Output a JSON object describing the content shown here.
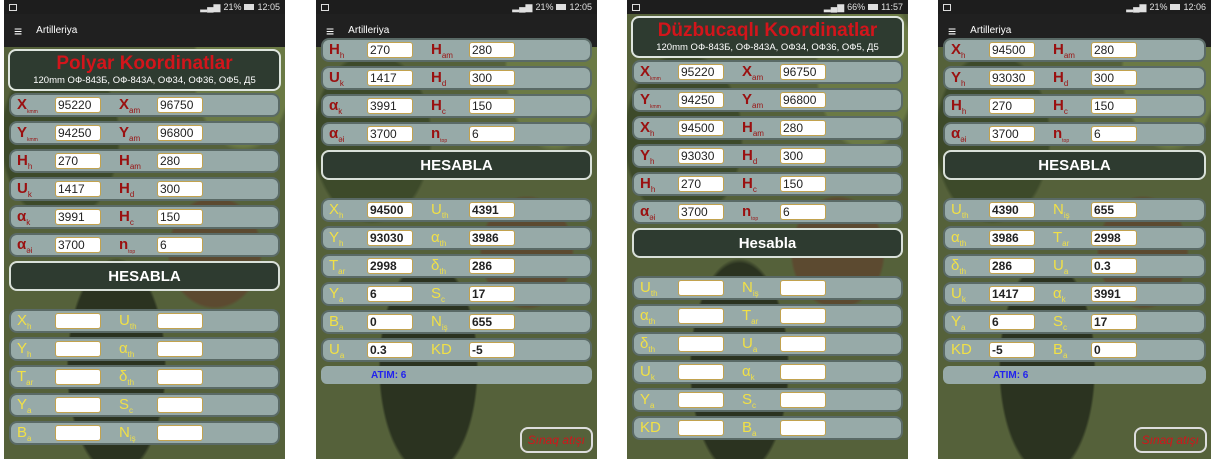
{
  "status": {
    "time1": "12:05",
    "time2": "12:05",
    "time3": "11:57",
    "time4": "12:06",
    "batt_a": "21%",
    "batt_b": "66%"
  },
  "app": {
    "title": "Artilleriya"
  },
  "screen1": {
    "title": "Polyar Koordinatlar",
    "subtitle": "120mm ОФ-843Б, ОФ-843А, ОФ34, ОФ36, ОФ5, Д5",
    "rows": [
      {
        "l1": "X",
        "s1": "kmm",
        "v1": "95220",
        "l2": "X",
        "s2": "am",
        "v2": "96750"
      },
      {
        "l1": "Y",
        "s1": "kmm",
        "v1": "94250",
        "l2": "Y",
        "s2": "am",
        "v2": "96800"
      },
      {
        "l1": "H",
        "s1": "h",
        "v1": "270",
        "l2": "H",
        "s2": "am",
        "v2": "280"
      },
      {
        "l1": "U",
        "s1": "k",
        "v1": "1417",
        "l2": "H",
        "s2": "d",
        "v2": "300"
      },
      {
        "l1": "α",
        "s1": "k",
        "v1": "3991",
        "l2": "H",
        "s2": "c",
        "v2": "150"
      },
      {
        "l1": "α",
        "s1": "əi",
        "v1": "3700",
        "l2": "n",
        "s2": "top",
        "v2": "6"
      }
    ],
    "button": "HESABLA",
    "results": [
      {
        "l1": "X",
        "s1": "h",
        "l2": "U",
        "s2": "th"
      },
      {
        "l1": "Y",
        "s1": "h",
        "l2": "α",
        "s2": "th"
      },
      {
        "l1": "T",
        "s1": "ar",
        "l2": "δ",
        "s2": "th"
      },
      {
        "l1": "Y",
        "s1": "a",
        "l2": "S",
        "s2": "c"
      },
      {
        "l1": "B",
        "s1": "a",
        "l2": "N",
        "s2": "iş"
      }
    ]
  },
  "screen2": {
    "rows": [
      {
        "l1": "H",
        "s1": "h",
        "v1": "270",
        "l2": "H",
        "s2": "am",
        "v2": "280"
      },
      {
        "l1": "U",
        "s1": "k",
        "v1": "1417",
        "l2": "H",
        "s2": "d",
        "v2": "300"
      },
      {
        "l1": "α",
        "s1": "k",
        "v1": "3991",
        "l2": "H",
        "s2": "c",
        "v2": "150"
      },
      {
        "l1": "α",
        "s1": "əi",
        "v1": "3700",
        "l2": "n",
        "s2": "top",
        "v2": "6"
      }
    ],
    "button": "HESABLA",
    "results": [
      {
        "l1": "X",
        "s1": "h",
        "v1": "94500",
        "l2": "U",
        "s2": "th",
        "v2": "4391"
      },
      {
        "l1": "Y",
        "s1": "h",
        "v1": "93030",
        "l2": "α",
        "s2": "th",
        "v2": "3986"
      },
      {
        "l1": "T",
        "s1": "ar",
        "v1": "2998",
        "l2": "δ",
        "s2": "th",
        "v2": "286"
      },
      {
        "l1": "Y",
        "s1": "a",
        "v1": "6",
        "l2": "S",
        "s2": "c",
        "v2": "17"
      },
      {
        "l1": "B",
        "s1": "a",
        "v1": "0",
        "l2": "N",
        "s2": "iş",
        "v2": "655"
      },
      {
        "l1": "U",
        "s1": "a",
        "v1": "0.3",
        "l2": "KD",
        "s2": "",
        "v2": "-5"
      }
    ],
    "atim": "ATIM: 6",
    "sinaq": "Sınaq atışı"
  },
  "screen3": {
    "title": "Düzbucaqlı Koordinatlar",
    "subtitle": "120mm ОФ-843Б, ОФ-843А, ОФ34, ОФ36, ОФ5, Д5",
    "rows": [
      {
        "l1": "X",
        "s1": "kmm",
        "v1": "95220",
        "l2": "X",
        "s2": "am",
        "v2": "96750"
      },
      {
        "l1": "Y",
        "s1": "kmm",
        "v1": "94250",
        "l2": "Y",
        "s2": "am",
        "v2": "96800"
      },
      {
        "l1": "X",
        "s1": "h",
        "v1": "94500",
        "l2": "H",
        "s2": "am",
        "v2": "280"
      },
      {
        "l1": "Y",
        "s1": "h",
        "v1": "93030",
        "l2": "H",
        "s2": "d",
        "v2": "300"
      },
      {
        "l1": "H",
        "s1": "h",
        "v1": "270",
        "l2": "H",
        "s2": "c",
        "v2": "150"
      },
      {
        "l1": "α",
        "s1": "əi",
        "v1": "3700",
        "l2": "n",
        "s2": "top",
        "v2": "6"
      }
    ],
    "button": "Hesabla",
    "results": [
      {
        "l1": "U",
        "s1": "th",
        "l2": "N",
        "s2": "iş"
      },
      {
        "l1": "α",
        "s1": "th",
        "l2": "T",
        "s2": "ar"
      },
      {
        "l1": "δ",
        "s1": "th",
        "l2": "U",
        "s2": "a"
      },
      {
        "l1": "U",
        "s1": "k",
        "l2": "α",
        "s2": "k"
      },
      {
        "l1": "Y",
        "s1": "a",
        "l2": "S",
        "s2": "c"
      },
      {
        "l1": "KD",
        "s1": "",
        "l2": "B",
        "s2": "a"
      }
    ]
  },
  "screen4": {
    "rows": [
      {
        "l1": "X",
        "s1": "h",
        "v1": "94500",
        "l2": "H",
        "s2": "am",
        "v2": "280"
      },
      {
        "l1": "Y",
        "s1": "h",
        "v1": "93030",
        "l2": "H",
        "s2": "d",
        "v2": "300"
      },
      {
        "l1": "H",
        "s1": "h",
        "v1": "270",
        "l2": "H",
        "s2": "c",
        "v2": "150"
      },
      {
        "l1": "α",
        "s1": "əi",
        "v1": "3700",
        "l2": "n",
        "s2": "top",
        "v2": "6"
      }
    ],
    "button": "HESABLA",
    "results": [
      {
        "l1": "U",
        "s1": "th",
        "v1": "4390",
        "l2": "N",
        "s2": "iş",
        "v2": "655"
      },
      {
        "l1": "α",
        "s1": "th",
        "v1": "3986",
        "l2": "T",
        "s2": "ar",
        "v2": "2998"
      },
      {
        "l1": "δ",
        "s1": "th",
        "v1": "286",
        "l2": "U",
        "s2": "a",
        "v2": "0.3"
      },
      {
        "l1": "U",
        "s1": "k",
        "v1": "1417",
        "l2": "α",
        "s2": "k",
        "v2": "3991"
      },
      {
        "l1": "Y",
        "s1": "a",
        "v1": "6",
        "l2": "S",
        "s2": "c",
        "v2": "17"
      },
      {
        "l1": "KD",
        "s1": "",
        "v1": "-5",
        "l2": "B",
        "s2": "a",
        "v2": "0"
      }
    ],
    "atim": "ATIM: 6",
    "sinaq": "Sınaq atışı"
  }
}
